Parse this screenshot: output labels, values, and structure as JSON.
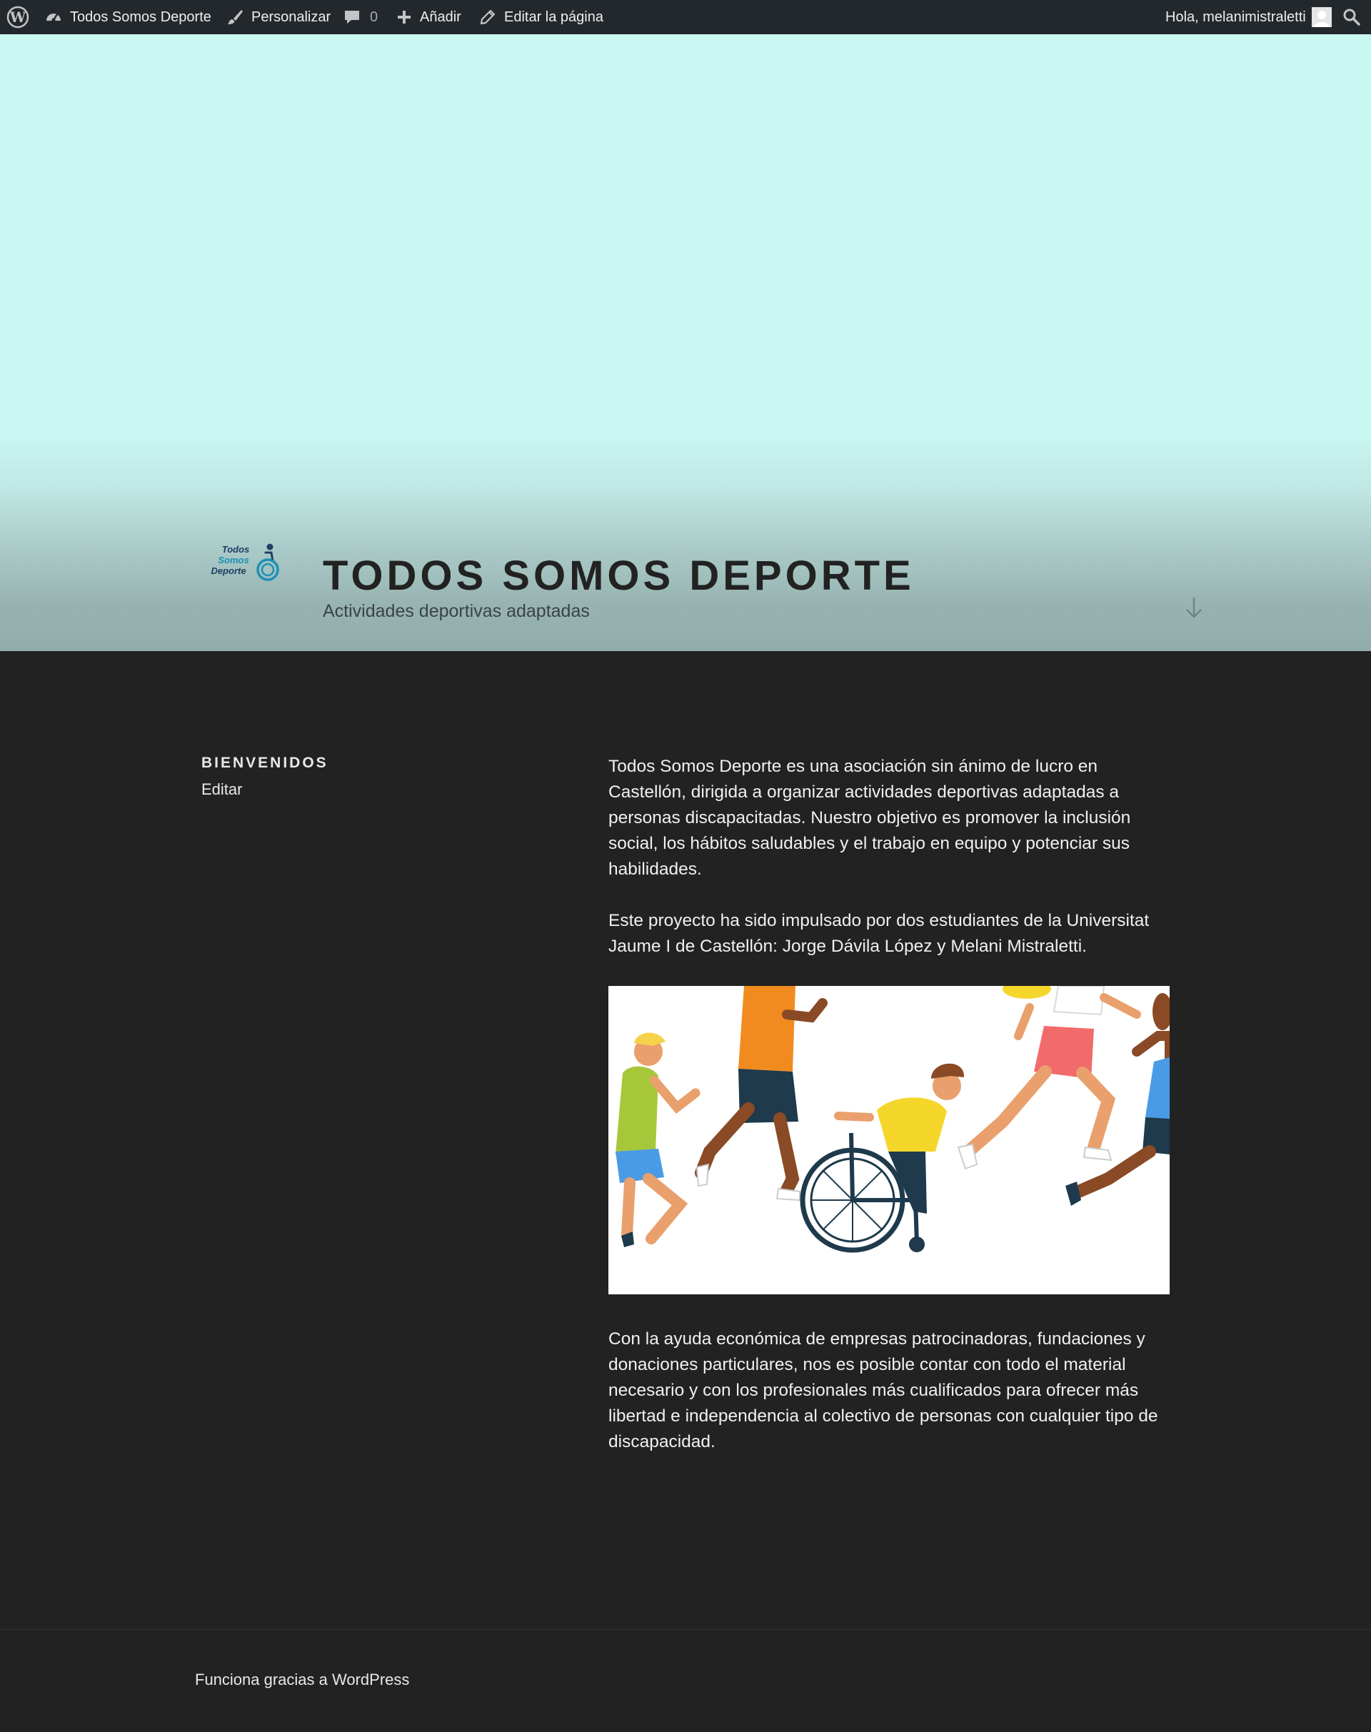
{
  "admin_bar": {
    "site_name": "Todos Somos Deporte",
    "customize": "Personalizar",
    "comments_count": "0",
    "new": "Añadir",
    "edit_page": "Editar la página",
    "greeting": "Hola, melanimistraletti"
  },
  "header": {
    "logo_text": [
      "Todos",
      "Somos",
      "Deporte"
    ],
    "title": "TODOS SOMOS DEPORTE",
    "description": "Actividades deportivas adaptadas"
  },
  "widget": {
    "title": "BIENVENIDOS",
    "edit": "Editar"
  },
  "content": {
    "paragraph1": "Todos Somos Deporte es una asociación sin ánimo de lucro en Castellón, dirigida a organizar actividades deportivas adaptadas a personas discapacitadas. Nuestro objetivo es promover la inclusión social, los hábitos saludables y el trabajo en equipo y potenciar sus habilidades.",
    "paragraph2": "Este proyecto ha sido impulsado por dos estudiantes de la Universitat Jaume I de Castellón: Jorge Dávila López y Melani Mistraletti.",
    "paragraph3": "Con la ayuda económica de empresas patrocinadoras, fundaciones y donaciones particulares, nos es posible contar con todo el material necesario y con los profesionales más cualificados para ofrecer más libertad e independencia al colectivo de personas con cualquier tipo de discapacidad."
  },
  "footer": {
    "credit": "Funciona gracias a WordPress"
  },
  "colors": {
    "admin_bar": "#23282d",
    "header_top": "#c9f7f2",
    "header_bottom": "#92acaa",
    "page_bg": "#222222",
    "logo_accent": "#1d8fb5"
  },
  "icons": [
    "wordpress-logo-icon",
    "dashboard-icon",
    "paintbrush-icon",
    "comment-icon",
    "plus-icon",
    "pencil-icon",
    "avatar-icon",
    "search-icon",
    "arrow-down-icon"
  ]
}
